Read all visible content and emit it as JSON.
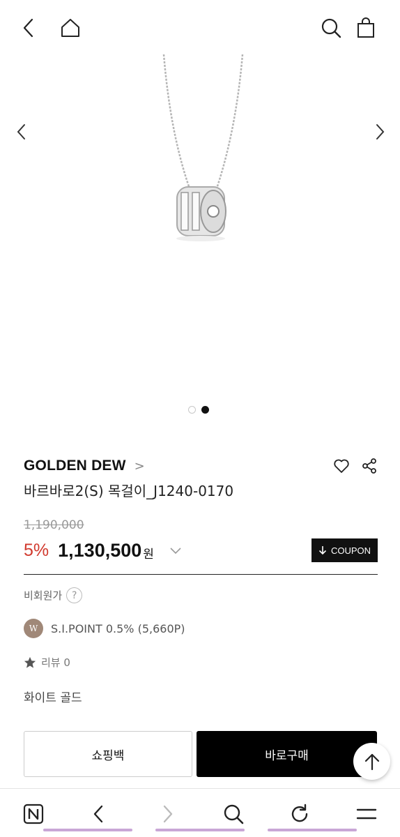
{
  "header": {
    "back_icon": "back-chevron-icon",
    "home_icon": "home-icon",
    "search_icon": "search-icon",
    "cart_icon": "shopping-bag-icon"
  },
  "gallery": {
    "slide_count": 2,
    "active_index": 1
  },
  "product": {
    "brand": "GOLDEN DEW",
    "brand_chevron": ">",
    "name": "바르바로2(S) 목걸이_J1240-0170",
    "original_price": "1,190,000",
    "discount": "5%",
    "price": "1,130,500",
    "currency": "원",
    "coupon_label": "COUPON",
    "nonmember_label": "비회원가",
    "nonmember_help": "?",
    "point_logo_text": "W",
    "point_text": "S.I.POINT 0.5% (5,660P)",
    "review_text": "리뷰 0",
    "color_option": "화이트 골드"
  },
  "actions": {
    "shopping_bag_label": "쇼핑백",
    "buy_now_label": "바로구매"
  },
  "colors": {
    "discount": "#d13a2e",
    "underline": "#c9a6d6",
    "point_logo": "#a08878"
  }
}
